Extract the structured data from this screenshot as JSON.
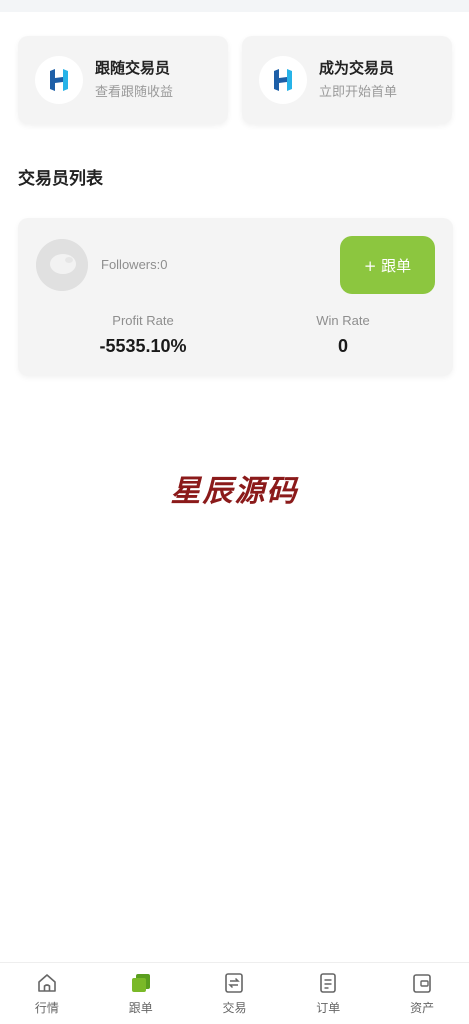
{
  "feature_cards": [
    {
      "title": "跟随交易员",
      "subtitle": "查看跟随收益",
      "icon": "h-logo-icon"
    },
    {
      "title": "成为交易员",
      "subtitle": "立即开始首单",
      "icon": "h-logo-icon"
    }
  ],
  "section_title": "交易员列表",
  "trader": {
    "followers": "Followers:0",
    "follow_button": "+ 跟单",
    "profit_rate_label": "Profit Rate",
    "profit_rate_value": "-5535.10%",
    "win_rate_label": "Win Rate",
    "win_rate_value": "0"
  },
  "watermark": "星辰源码",
  "tabbar": [
    {
      "label": "行情",
      "icon": "home-icon",
      "active": false
    },
    {
      "label": "跟单",
      "icon": "copy-trade-icon",
      "active": true
    },
    {
      "label": "交易",
      "icon": "exchange-icon",
      "active": false
    },
    {
      "label": "订单",
      "icon": "order-icon",
      "active": false
    },
    {
      "label": "资产",
      "icon": "wallet-icon",
      "active": false
    }
  ],
  "colors": {
    "accent": "#8cc63f",
    "card_bg": "#f4f4f4",
    "watermark": "#8b1a1a",
    "logo_blue": "#1d5fa8",
    "logo_cyan": "#27b3e8"
  }
}
